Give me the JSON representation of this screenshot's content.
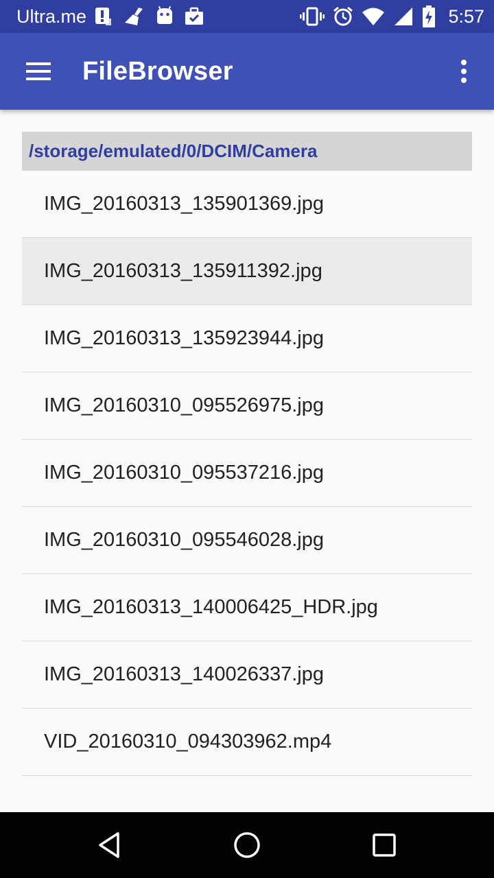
{
  "status_bar": {
    "carrier": "Ultra.me",
    "time": "5:57",
    "left_icons": [
      "alert-sim-icon",
      "broom-icon",
      "android-icon",
      "briefcase-check-icon"
    ],
    "right_icons": [
      "vibrate-icon",
      "alarm-icon",
      "wifi-icon",
      "signal-icon",
      "battery-charging-icon"
    ]
  },
  "app_bar": {
    "title": "FileBrowser",
    "menu_icon": "hamburger-menu-icon",
    "overflow_icon": "more-vert-icon",
    "color": "#3f51b5",
    "status_color": "#303f9f"
  },
  "path": "/storage/emulated/0/DCIM/Camera",
  "files": [
    {
      "name": "IMG_20160313_135901369.jpg",
      "selected": false
    },
    {
      "name": "IMG_20160313_135911392.jpg",
      "selected": true
    },
    {
      "name": "IMG_20160313_135923944.jpg",
      "selected": false
    },
    {
      "name": "IMG_20160310_095526975.jpg",
      "selected": false
    },
    {
      "name": "IMG_20160310_095537216.jpg",
      "selected": false
    },
    {
      "name": "IMG_20160310_095546028.jpg",
      "selected": false
    },
    {
      "name": "IMG_20160313_140006425_HDR.jpg",
      "selected": false
    },
    {
      "name": "IMG_20160313_140026337.jpg",
      "selected": false
    },
    {
      "name": "VID_20160310_094303962.mp4",
      "selected": false
    }
  ],
  "nav_bar": {
    "icons": [
      "back-icon",
      "home-icon",
      "recents-icon"
    ]
  }
}
